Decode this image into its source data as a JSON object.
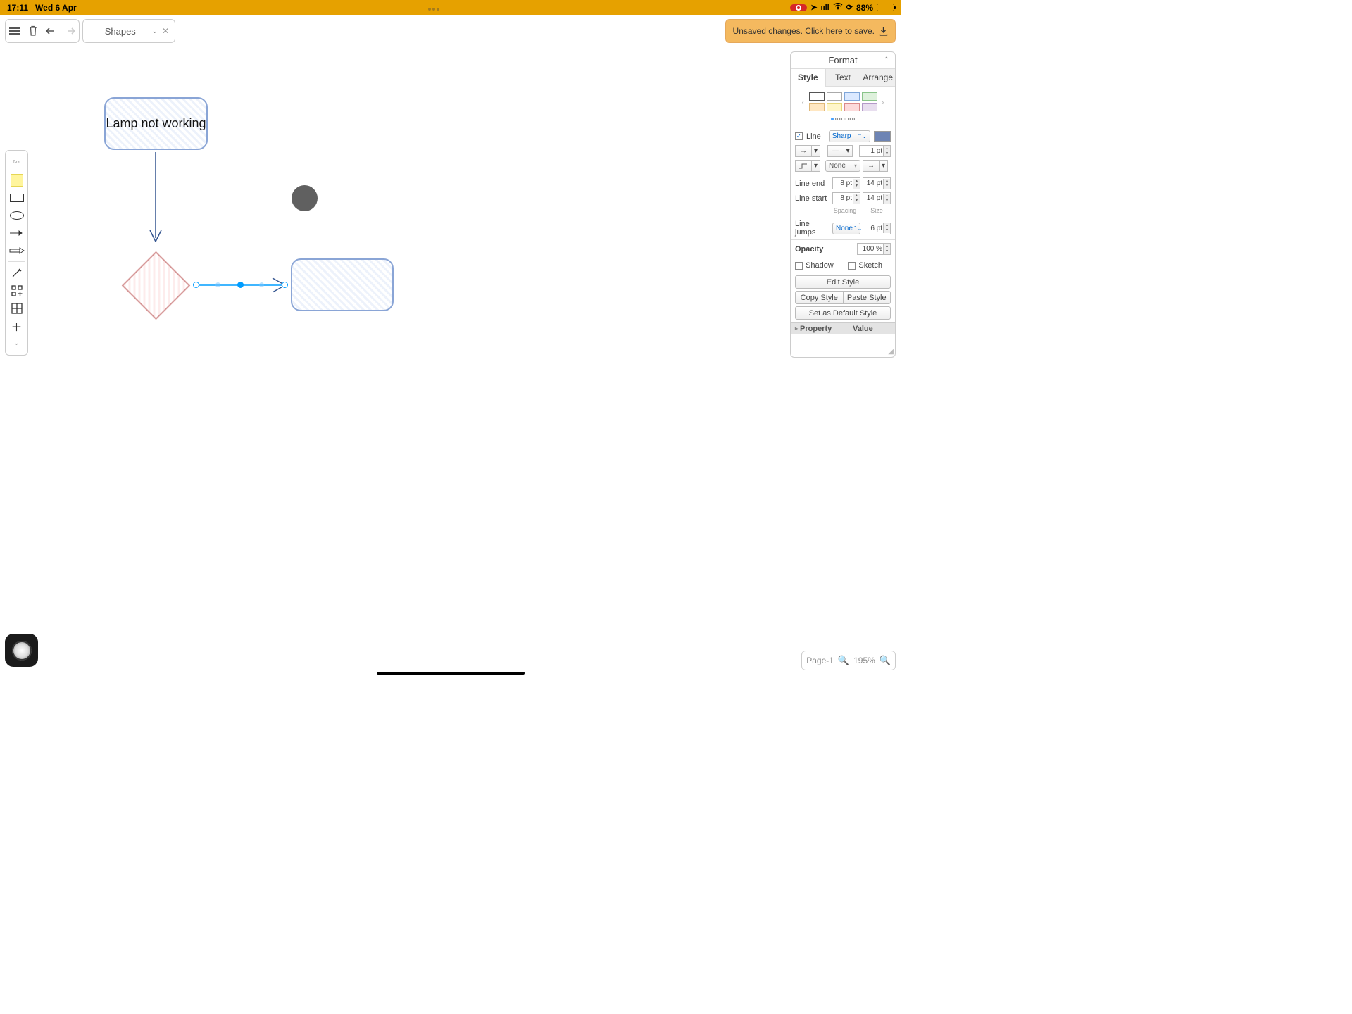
{
  "statusbar": {
    "time": "17:11",
    "date": "Wed 6 Apr",
    "battery_pct": "88%"
  },
  "toolbar": {
    "library_name": "Shapes"
  },
  "save_bar": {
    "message": "Unsaved changes. Click here to save."
  },
  "canvas": {
    "box1_text": "Lamp not working"
  },
  "format": {
    "title": "Format",
    "tabs": {
      "style": "Style",
      "text": "Text",
      "arrange": "Arrange"
    },
    "line": {
      "label": "Line",
      "type": "Sharp",
      "width": "1 pt",
      "waypoint_style": "None",
      "end_label": "Line end",
      "end_a": "8 pt",
      "end_b": "14 pt",
      "start_label": "Line start",
      "start_a": "8 pt",
      "start_b": "14 pt",
      "spacing_label": "Spacing",
      "size_label": "Size",
      "jumps_label": "Line jumps",
      "jumps_style": "None",
      "jumps_size": "6 pt"
    },
    "opacity": {
      "label": "Opacity",
      "value": "100 %"
    },
    "shadow_label": "Shadow",
    "sketch_label": "Sketch",
    "buttons": {
      "edit": "Edit Style",
      "copy": "Copy Style",
      "paste": "Paste Style",
      "default": "Set as Default Style"
    },
    "properties": {
      "col1": "Property",
      "col2": "Value"
    }
  },
  "footer": {
    "page": "Page-1",
    "zoom": "195%"
  }
}
